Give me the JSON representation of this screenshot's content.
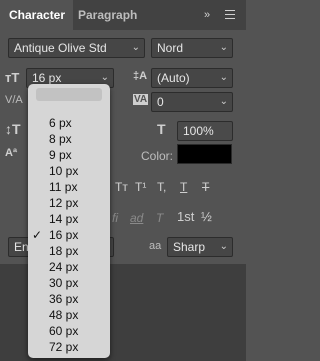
{
  "tabs": {
    "character": "Character",
    "paragraph": "Paragraph",
    "collapse": "»"
  },
  "font": {
    "family": "Antique Olive Std",
    "style": "Nord"
  },
  "size": {
    "value": "16 px"
  },
  "leading": {
    "value": "(Auto)"
  },
  "kerning": {
    "label": "V/A"
  },
  "tracking": {
    "value": "0"
  },
  "scale": {
    "value": "100%"
  },
  "color": {
    "label": "Color:",
    "value": "#000000"
  },
  "typebuttons": [
    "Tт",
    "T¹",
    "T,",
    "T",
    "T"
  ],
  "otbuttons": [
    "fi",
    "ad",
    "T",
    "1st",
    "½"
  ],
  "language": {
    "value": "En"
  },
  "antialias": {
    "label": "aa",
    "value": "Sharp"
  },
  "size_options": [
    "6 px",
    "8 px",
    "9 px",
    "10 px",
    "11 px",
    "12 px",
    "14 px",
    "16 px",
    "18 px",
    "24 px",
    "30 px",
    "36 px",
    "48 px",
    "60 px",
    "72 px"
  ],
  "selected_size": "16 px"
}
